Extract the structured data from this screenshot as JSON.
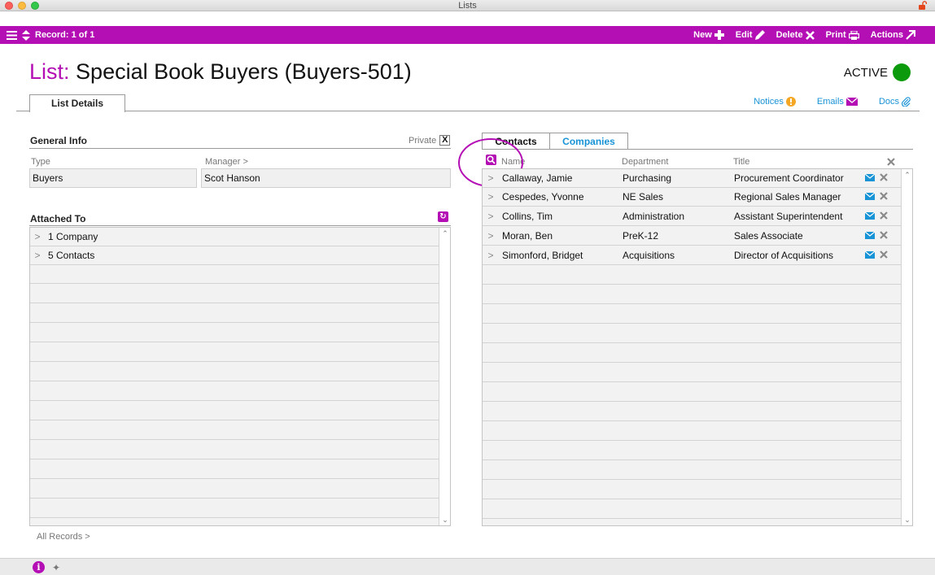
{
  "window": {
    "title": "Lists"
  },
  "toolbar": {
    "record_label": "Record: 1 of 1",
    "new_label": "New",
    "edit_label": "Edit",
    "delete_label": "Delete",
    "print_label": "Print",
    "actions_label": "Actions"
  },
  "header": {
    "title_prefix": "List:",
    "title": "Special Book Buyers  (Buyers-501)",
    "status": "ACTIVE",
    "status_color": "#0b9a0b",
    "tab_details": "List Details",
    "links": {
      "notices": "Notices",
      "emails": "Emails",
      "docs": "Docs"
    }
  },
  "general_info": {
    "heading": "General Info",
    "private_label": "Private",
    "private_checked": "X",
    "type_label": "Type",
    "type_value": "Buyers",
    "manager_label": "Manager >",
    "manager_value": "Scot Hanson"
  },
  "attached_to": {
    "heading": "Attached To",
    "rows": [
      {
        "chev": ">",
        "label": "1 Company"
      },
      {
        "chev": ">",
        "label": "5 Contacts"
      }
    ]
  },
  "footer": {
    "all_records": "All Records >"
  },
  "contacts_panel": {
    "tab_contacts": "Contacts",
    "tab_companies": "Companies",
    "columns": {
      "name": "Name",
      "department": "Department",
      "title": "Title"
    },
    "rows": [
      {
        "chev": ">",
        "name": "Callaway, Jamie",
        "department": "Purchasing",
        "title": "Procurement Coordinator"
      },
      {
        "chev": ">",
        "name": "Cespedes, Yvonne",
        "department": "NE Sales",
        "title": "Regional Sales Manager"
      },
      {
        "chev": ">",
        "name": "Collins, Tim",
        "department": "Administration",
        "title": "Assistant Superintendent"
      },
      {
        "chev": ">",
        "name": "Moran, Ben",
        "department": "PreK-12",
        "title": "Sales Associate"
      },
      {
        "chev": ">",
        "name": "Simonford, Bridget",
        "department": "Acquisitions",
        "title": "Director of Acquisitions"
      }
    ]
  },
  "colors": {
    "accent": "#b40fb4",
    "link": "#1893d6",
    "notice": "#f5a623"
  },
  "icons": [
    "hamburger-icon",
    "sort-arrows-icon",
    "plus-icon",
    "pencil-icon",
    "x-icon",
    "printer-icon",
    "arrow-out-icon",
    "lock-open-icon",
    "warning-icon",
    "envelope-icon",
    "paperclip-icon",
    "refresh-icon",
    "search-icon",
    "info-icon",
    "pin-icon"
  ]
}
